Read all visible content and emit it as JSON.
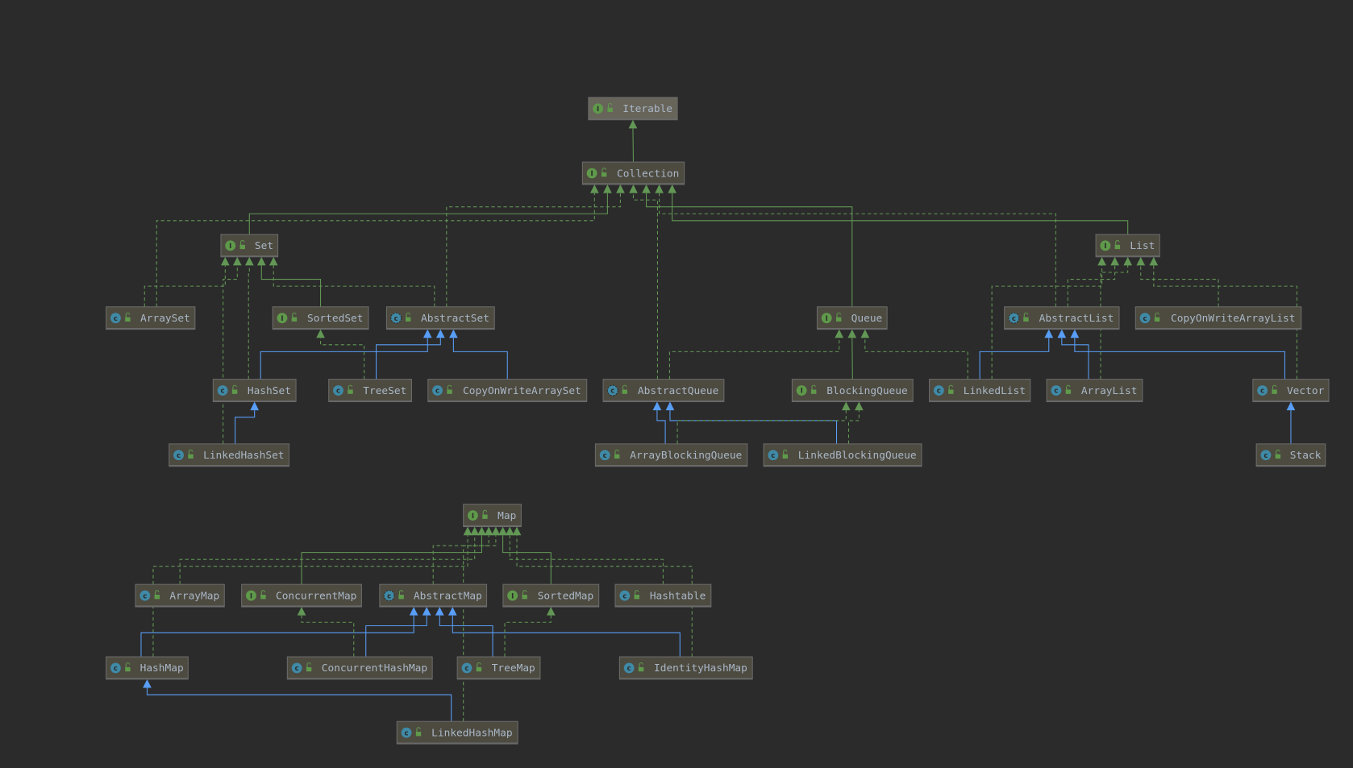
{
  "colors": {
    "background": "#2b2b2b",
    "node_fill": "#4d4a40",
    "node_fill_root": "#67645a",
    "text": "#a9b7c6",
    "interface_icon": "#5f9a4a",
    "class_icon": "#3f8aa6",
    "interface_edge": "#629755",
    "class_edge": "#589df6"
  },
  "nodes": [
    {
      "id": "Iterable",
      "label": "Iterable",
      "kind": "interface"
    },
    {
      "id": "Collection",
      "label": "Collection",
      "kind": "interface"
    },
    {
      "id": "Set",
      "label": "Set",
      "kind": "interface"
    },
    {
      "id": "List",
      "label": "List",
      "kind": "interface"
    },
    {
      "id": "ArraySet",
      "label": "ArraySet",
      "kind": "class"
    },
    {
      "id": "SortedSet",
      "label": "SortedSet",
      "kind": "interface"
    },
    {
      "id": "AbstractSet",
      "label": "AbstractSet",
      "kind": "abstract"
    },
    {
      "id": "Queue",
      "label": "Queue",
      "kind": "interface"
    },
    {
      "id": "AbstractList",
      "label": "AbstractList",
      "kind": "abstract"
    },
    {
      "id": "CopyOnWriteArrayList",
      "label": "CopyOnWriteArrayList",
      "kind": "class"
    },
    {
      "id": "HashSet",
      "label": "HashSet",
      "kind": "class"
    },
    {
      "id": "TreeSet",
      "label": "TreeSet",
      "kind": "class"
    },
    {
      "id": "CopyOnWriteArraySet",
      "label": "CopyOnWriteArraySet",
      "kind": "class"
    },
    {
      "id": "AbstractQueue",
      "label": "AbstractQueue",
      "kind": "abstract"
    },
    {
      "id": "BlockingQueue",
      "label": "BlockingQueue",
      "kind": "interface"
    },
    {
      "id": "LinkedList",
      "label": "LinkedList",
      "kind": "class"
    },
    {
      "id": "ArrayList",
      "label": "ArrayList",
      "kind": "class"
    },
    {
      "id": "Vector",
      "label": "Vector",
      "kind": "class"
    },
    {
      "id": "LinkedHashSet",
      "label": "LinkedHashSet",
      "kind": "class"
    },
    {
      "id": "ArrayBlockingQueue",
      "label": "ArrayBlockingQueue",
      "kind": "class"
    },
    {
      "id": "LinkedBlockingQueue",
      "label": "LinkedBlockingQueue",
      "kind": "class"
    },
    {
      "id": "Stack",
      "label": "Stack",
      "kind": "class"
    },
    {
      "id": "Map",
      "label": "Map",
      "kind": "interface"
    },
    {
      "id": "ArrayMap",
      "label": "ArrayMap",
      "kind": "class"
    },
    {
      "id": "ConcurrentMap",
      "label": "ConcurrentMap",
      "kind": "interface"
    },
    {
      "id": "AbstractMap",
      "label": "AbstractMap",
      "kind": "abstract"
    },
    {
      "id": "SortedMap",
      "label": "SortedMap",
      "kind": "interface"
    },
    {
      "id": "Hashtable",
      "label": "Hashtable",
      "kind": "class"
    },
    {
      "id": "HashMap",
      "label": "HashMap",
      "kind": "class"
    },
    {
      "id": "ConcurrentHashMap",
      "label": "ConcurrentHashMap",
      "kind": "class"
    },
    {
      "id": "TreeMap",
      "label": "TreeMap",
      "kind": "class"
    },
    {
      "id": "IdentityHashMap",
      "label": "IdentityHashMap",
      "kind": "class"
    },
    {
      "id": "LinkedHashMap",
      "label": "LinkedHashMap",
      "kind": "class"
    }
  ],
  "edges": [
    {
      "from": "Collection",
      "to": "Iterable",
      "kind": "extends-interface"
    },
    {
      "from": "Set",
      "to": "Collection",
      "kind": "extends-interface"
    },
    {
      "from": "List",
      "to": "Collection",
      "kind": "extends-interface"
    },
    {
      "from": "Queue",
      "to": "Collection",
      "kind": "extends-interface"
    },
    {
      "from": "ArraySet",
      "to": "Collection",
      "kind": "implements"
    },
    {
      "from": "AbstractSet",
      "to": "Collection",
      "kind": "implements"
    },
    {
      "from": "AbstractQueue",
      "to": "Collection",
      "kind": "implements"
    },
    {
      "from": "AbstractList",
      "to": "Collection",
      "kind": "implements"
    },
    {
      "from": "ArraySet",
      "to": "Set",
      "kind": "implements"
    },
    {
      "from": "SortedSet",
      "to": "Set",
      "kind": "extends-interface"
    },
    {
      "from": "AbstractSet",
      "to": "Set",
      "kind": "implements"
    },
    {
      "from": "HashSet",
      "to": "Set",
      "kind": "implements"
    },
    {
      "from": "LinkedHashSet",
      "to": "Set",
      "kind": "implements"
    },
    {
      "from": "HashSet",
      "to": "AbstractSet",
      "kind": "extends-class"
    },
    {
      "from": "TreeSet",
      "to": "AbstractSet",
      "kind": "extends-class"
    },
    {
      "from": "CopyOnWriteArraySet",
      "to": "AbstractSet",
      "kind": "extends-class"
    },
    {
      "from": "TreeSet",
      "to": "SortedSet",
      "kind": "implements"
    },
    {
      "from": "LinkedHashSet",
      "to": "HashSet",
      "kind": "extends-class"
    },
    {
      "from": "BlockingQueue",
      "to": "Queue",
      "kind": "extends-interface"
    },
    {
      "from": "AbstractQueue",
      "to": "Queue",
      "kind": "implements"
    },
    {
      "from": "LinkedList",
      "to": "Queue",
      "kind": "implements"
    },
    {
      "from": "ArrayBlockingQueue",
      "to": "AbstractQueue",
      "kind": "extends-class"
    },
    {
      "from": "LinkedBlockingQueue",
      "to": "AbstractQueue",
      "kind": "extends-class"
    },
    {
      "from": "ArrayBlockingQueue",
      "to": "BlockingQueue",
      "kind": "implements"
    },
    {
      "from": "LinkedBlockingQueue",
      "to": "BlockingQueue",
      "kind": "implements"
    },
    {
      "from": "AbstractList",
      "to": "List",
      "kind": "implements"
    },
    {
      "from": "CopyOnWriteArrayList",
      "to": "List",
      "kind": "implements"
    },
    {
      "from": "LinkedList",
      "to": "List",
      "kind": "implements"
    },
    {
      "from": "ArrayList",
      "to": "List",
      "kind": "implements"
    },
    {
      "from": "Vector",
      "to": "List",
      "kind": "implements"
    },
    {
      "from": "LinkedList",
      "to": "AbstractList",
      "kind": "extends-class"
    },
    {
      "from": "ArrayList",
      "to": "AbstractList",
      "kind": "extends-class"
    },
    {
      "from": "Vector",
      "to": "AbstractList",
      "kind": "extends-class"
    },
    {
      "from": "Stack",
      "to": "Vector",
      "kind": "extends-class"
    },
    {
      "from": "ArrayMap",
      "to": "Map",
      "kind": "implements"
    },
    {
      "from": "HashMap",
      "to": "Map",
      "kind": "implements"
    },
    {
      "from": "ConcurrentMap",
      "to": "Map",
      "kind": "extends-interface"
    },
    {
      "from": "AbstractMap",
      "to": "Map",
      "kind": "implements"
    },
    {
      "from": "SortedMap",
      "to": "Map",
      "kind": "extends-interface"
    },
    {
      "from": "Hashtable",
      "to": "Map",
      "kind": "implements"
    },
    {
      "from": "IdentityHashMap",
      "to": "Map",
      "kind": "implements"
    },
    {
      "from": "LinkedHashMap",
      "to": "Map",
      "kind": "implements"
    },
    {
      "from": "HashMap",
      "to": "AbstractMap",
      "kind": "extends-class"
    },
    {
      "from": "ConcurrentHashMap",
      "to": "AbstractMap",
      "kind": "extends-class"
    },
    {
      "from": "TreeMap",
      "to": "AbstractMap",
      "kind": "extends-class"
    },
    {
      "from": "IdentityHashMap",
      "to": "AbstractMap",
      "kind": "extends-class"
    },
    {
      "from": "ConcurrentHashMap",
      "to": "ConcurrentMap",
      "kind": "implements"
    },
    {
      "from": "TreeMap",
      "to": "SortedMap",
      "kind": "implements"
    },
    {
      "from": "LinkedHashMap",
      "to": "HashMap",
      "kind": "extends-class"
    }
  ]
}
